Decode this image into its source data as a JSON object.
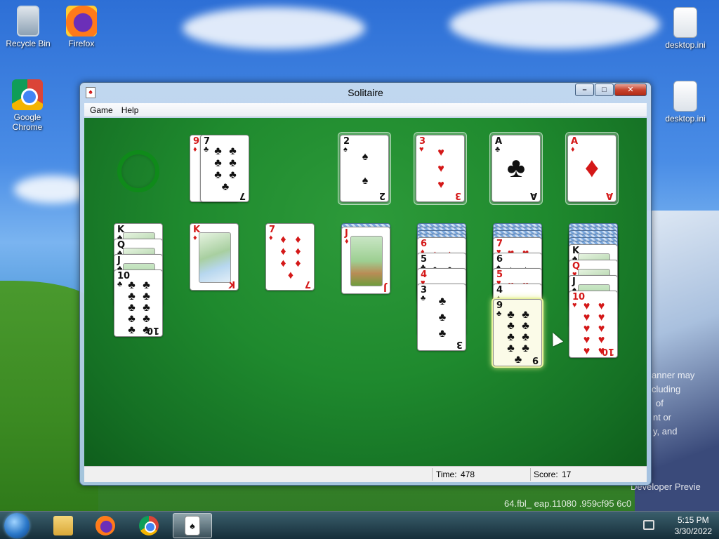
{
  "desktop": {
    "icons": [
      {
        "label": "Recycle Bin",
        "icon": "recycle-bin-icon"
      },
      {
        "label": "Firefox",
        "icon": "firefox-icon"
      },
      {
        "label": "Google Chrome",
        "icon": "chrome-icon"
      },
      {
        "label": "desktop.ini",
        "icon": "settings-file-icon"
      },
      {
        "label": "desktop.ini",
        "icon": "settings-file-icon"
      }
    ],
    "watermark_lines": [
      "anner may",
      "cluding",
      "of",
      "nt or",
      "y, and",
      "Developer Previe",
      "64.fbl_  eap.11080  .959cf95  6c0"
    ]
  },
  "window": {
    "title": "Solitaire",
    "menu": [
      "Game",
      "Help"
    ],
    "controls": {
      "minimize": "–",
      "maximize": "□",
      "close": "✕"
    }
  },
  "game": {
    "stock": {
      "empty": true
    },
    "waste": [
      {
        "rank": "9",
        "suit": "♦",
        "color": "red"
      },
      {
        "rank": "7",
        "suit": "♣",
        "color": "black"
      }
    ],
    "foundations": [
      {
        "rank": "2",
        "suit": "♠",
        "color": "black"
      },
      {
        "rank": "3",
        "suit": "♥",
        "color": "red"
      },
      {
        "rank": "A",
        "suit": "♣",
        "color": "black"
      },
      {
        "rank": "A",
        "suit": "♦",
        "color": "red"
      }
    ],
    "tableau": [
      {
        "hidden": 0,
        "cards": [
          {
            "rank": "K",
            "suit": "♣",
            "color": "black"
          },
          {
            "rank": "Q",
            "suit": "♣",
            "color": "black"
          },
          {
            "rank": "J",
            "suit": "♣",
            "color": "black"
          },
          {
            "rank": "10",
            "suit": "♣",
            "color": "black"
          }
        ]
      },
      {
        "hidden": 0,
        "cards": [
          {
            "rank": "K",
            "suit": "♦",
            "color": "red"
          }
        ]
      },
      {
        "hidden": 0,
        "cards": [
          {
            "rank": "7",
            "suit": "♦",
            "color": "red"
          }
        ]
      },
      {
        "hidden": 1,
        "cards": [
          {
            "rank": "J",
            "suit": "♦",
            "color": "red"
          }
        ]
      },
      {
        "hidden": 4,
        "cards": [
          {
            "rank": "6",
            "suit": "♦",
            "color": "red"
          },
          {
            "rank": "5",
            "suit": "♣",
            "color": "black"
          },
          {
            "rank": "4",
            "suit": "♥",
            "color": "red"
          },
          {
            "rank": "3",
            "suit": "♣",
            "color": "black"
          }
        ]
      },
      {
        "hidden": 4,
        "cards": [
          {
            "rank": "7",
            "suit": "♥",
            "color": "red"
          },
          {
            "rank": "6",
            "suit": "♠",
            "color": "black"
          },
          {
            "rank": "5",
            "suit": "♥",
            "color": "red"
          },
          {
            "rank": "4",
            "suit": "♠",
            "color": "black"
          },
          {
            "rank": "9",
            "suit": "♣",
            "color": "black",
            "selected": true
          }
        ]
      },
      {
        "hidden": 6,
        "cards": [
          {
            "rank": "K",
            "suit": "♣",
            "color": "black"
          },
          {
            "rank": "Q",
            "suit": "♥",
            "color": "red"
          },
          {
            "rank": "J",
            "suit": "♠",
            "color": "black"
          },
          {
            "rank": "10",
            "suit": "♥",
            "color": "red"
          }
        ]
      }
    ]
  },
  "status": {
    "time_label": "Time:",
    "time_value": "478",
    "score_label": "Score:",
    "score_value": "17"
  },
  "taskbar": {
    "items": [
      "file-explorer-icon",
      "firefox-icon",
      "chrome-icon",
      "solitaire-icon"
    ],
    "active": "solitaire-icon",
    "clock_time": "5:15 PM",
    "clock_date": "3/30/2022"
  }
}
